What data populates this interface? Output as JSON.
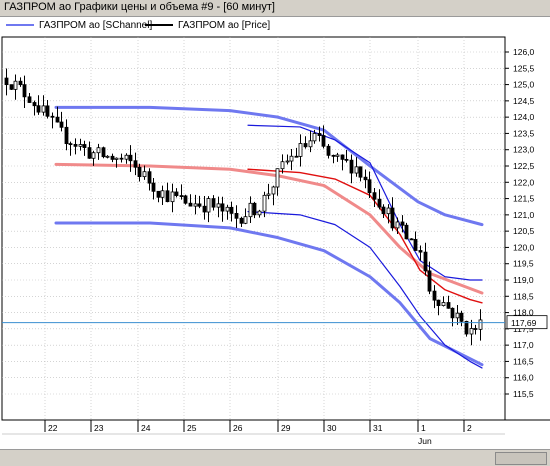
{
  "window": {
    "title": "ГАЗПРОМ ао Графики цены и объема #9 - [60 минут]"
  },
  "legend": {
    "items": [
      {
        "label": "ГАЗПРОМ ао [SChannel]",
        "color": "#6f78f0"
      },
      {
        "label": "ГАЗПРОМ ао [Price]",
        "color": "#000000"
      }
    ]
  },
  "price_label": "117,69",
  "chart_data": {
    "type": "candlestick",
    "y_ticks": [
      "126,0",
      "125,5",
      "125,0",
      "124,5",
      "124,0",
      "123,5",
      "123,0",
      "122,5",
      "122,0",
      "121,5",
      "121,0",
      "120,5",
      "120,0",
      "119,5",
      "119,0",
      "118,5",
      "118,0",
      "117,5",
      "117,0",
      "116,5",
      "116,0",
      "115,5"
    ],
    "ylim": [
      115.5,
      126.0
    ],
    "x_ticks": [
      "22",
      "23",
      "24",
      "25",
      "26",
      "29",
      "30",
      "31",
      "1",
      "2"
    ],
    "x_sublabel": "Jun",
    "grid": true,
    "current_price": 117.69,
    "colors": {
      "candle": "#000000",
      "channel_outer": "#6f78f0",
      "channel_inner": "#1a1adc",
      "mid_line": "#f08a8a",
      "mid_line_inner": "#e01010",
      "price_line": "#3a8ed0"
    }
  }
}
